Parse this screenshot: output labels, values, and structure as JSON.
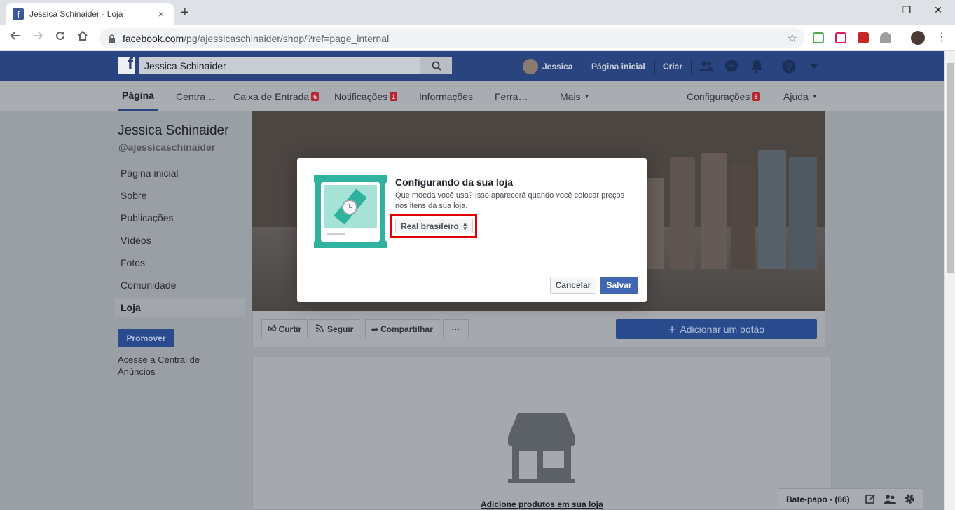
{
  "browser": {
    "tab_title": "Jessica Schinaider - Loja",
    "tab_close": "×",
    "new_tab": "+",
    "url_host": "facebook.com",
    "url_path": "/pg/ajessicaschinaider/shop/?ref=page_internal",
    "win_min": "—",
    "win_max": "❐",
    "win_close": "✕"
  },
  "fb_header": {
    "search_value": "Jessica Schinaider",
    "user_name": "Jessica",
    "home": "Página inicial",
    "create": "Criar"
  },
  "page_tabs": {
    "pagina": "Página",
    "central": "Centra…",
    "inbox": "Caixa de Entrada",
    "inbox_badge": "6",
    "notifications": "Notificações",
    "notifications_badge": "1",
    "info": "Informações",
    "tools": "Ferra…",
    "more": "Mais",
    "settings": "Configurações",
    "settings_badge": "3",
    "help": "Ajuda"
  },
  "left_nav": {
    "page_name": "Jessica Schinaider",
    "handle": "@ajessicaschinaider",
    "items": [
      "Página inicial",
      "Sobre",
      "Publicações",
      "Vídeos",
      "Fotos",
      "Comunidade",
      "Loja"
    ],
    "promote": "Promover",
    "ads_link": "Acesse a Central de Anúncios"
  },
  "actions": {
    "like": "Curtir",
    "follow": "Seguir",
    "share": "Compartilhar",
    "more": "···",
    "add_button": "Adicionar um botão"
  },
  "shop": {
    "empty_text": "Adicione produtos em sua loja"
  },
  "chat": {
    "label": "Bate-papo - (66)"
  },
  "modal": {
    "title": "Configurando da sua loja",
    "description": "Que moeda você usa? Isso aparecerá quando você colocar preços nos itens da sua loja.",
    "currency_selected": "Real brasileiro",
    "cancel": "Cancelar",
    "save": "Salvar"
  },
  "colors": {
    "fb_blue": "#4267b2",
    "highlight": "#e00000",
    "illustration": "#2fb39f"
  }
}
